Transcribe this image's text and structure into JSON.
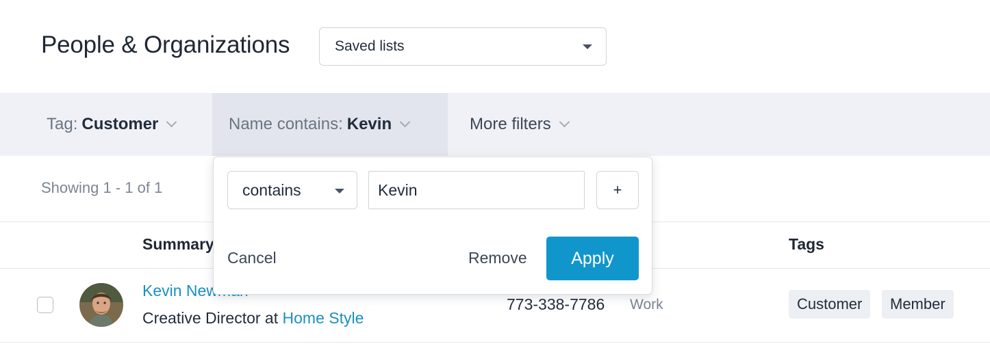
{
  "header": {
    "title": "People & Organizations",
    "saved_lists": {
      "label": "Saved lists",
      "icon": "caret-down-icon"
    }
  },
  "filters": {
    "tag": {
      "label": "Tag:",
      "value": "Customer"
    },
    "name": {
      "label": "Name contains:",
      "value": "Kevin"
    },
    "more": {
      "label": "More filters"
    }
  },
  "results": {
    "showing": "Showing 1 - 1 of 1"
  },
  "table": {
    "columns": {
      "summary": "Summary",
      "tags": "Tags"
    },
    "rows": [
      {
        "name": "Kevin Newman",
        "role_prefix": "Creative Director at",
        "organization": "Home Style",
        "phone": "773-338-7786",
        "phone_type": "Work",
        "tags": [
          "Customer",
          "Member"
        ]
      }
    ]
  },
  "popover": {
    "operator": "contains",
    "value": "Kevin",
    "add_label": "+",
    "cancel_label": "Cancel",
    "remove_label": "Remove",
    "apply_label": "Apply"
  },
  "colors": {
    "accent": "#1196cc",
    "link": "#1a8fc4",
    "filter_bar": "#eff1f6",
    "filter_active": "#e2e5ed"
  }
}
